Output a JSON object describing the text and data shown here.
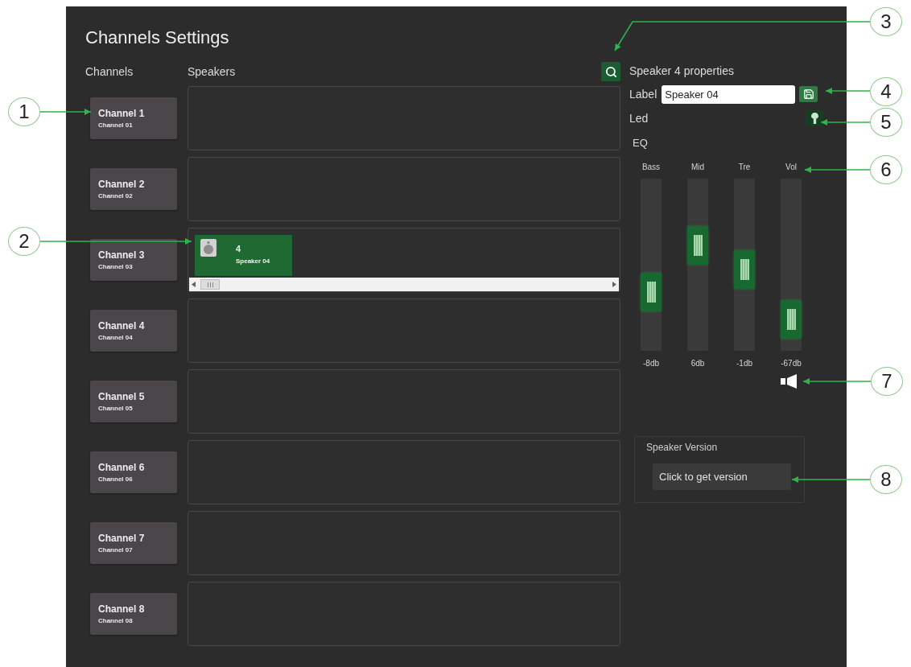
{
  "title": "Channels Settings",
  "headers": {
    "channels": "Channels",
    "speakers": "Speakers"
  },
  "channels": [
    {
      "name": "Channel 1",
      "code": "Channel 01"
    },
    {
      "name": "Channel 2",
      "code": "Channel 02"
    },
    {
      "name": "Channel 3",
      "code": "Channel 03",
      "speakers": [
        {
          "number": "4",
          "label": "Speaker 04",
          "selected": true
        }
      ]
    },
    {
      "name": "Channel 4",
      "code": "Channel 04"
    },
    {
      "name": "Channel 5",
      "code": "Channel 05"
    },
    {
      "name": "Channel 6",
      "code": "Channel 06"
    },
    {
      "name": "Channel 7",
      "code": "Channel 07"
    },
    {
      "name": "Channel 8",
      "code": "Channel 08"
    }
  ],
  "properties": {
    "title": "Speaker 4 properties",
    "label_caption": "Label",
    "label_value": "Speaker 04",
    "led_caption": "Led",
    "eq_caption": "EQ",
    "eq_bands": [
      {
        "name": "Bass",
        "level": 0.34,
        "reading": "-8db"
      },
      {
        "name": "Mid",
        "level": 0.61,
        "reading": "6db"
      },
      {
        "name": "Tre",
        "level": 0.47,
        "reading": "-1db"
      },
      {
        "name": "Vol",
        "level": 0.18,
        "reading": "-67db"
      }
    ],
    "version": {
      "title": "Speaker Version",
      "button": "Click to get version"
    }
  },
  "callouts": [
    {
      "number": "1"
    },
    {
      "number": "2"
    },
    {
      "number": "3"
    },
    {
      "number": "4"
    },
    {
      "number": "5"
    },
    {
      "number": "6"
    },
    {
      "number": "7"
    },
    {
      "number": "8"
    }
  ]
}
